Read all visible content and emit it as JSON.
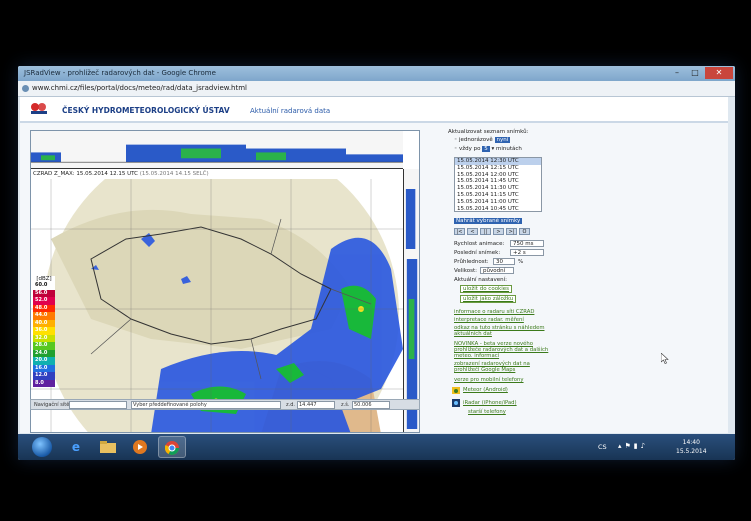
{
  "browser": {
    "title": "JSRadView - prohlížeč radarových dat - Google Chrome",
    "url": "www.chmi.cz/files/portal/docs/meteo/rad/data_jsradview.html"
  },
  "header": {
    "org_name": "ČESKÝ HYDROMETEOROLOGICKÝ ÚSTAV",
    "nav_link": "Aktuální radarová data"
  },
  "radar": {
    "product_title": "CZRAD Z_MAX: 15.05.2014 12.15 UTC",
    "product_title_local": "(15.05.2014 14.15 SELČ)",
    "legend_unit": "[dBZ]",
    "legend": [
      {
        "label": "60.0",
        "color": "#ffffff"
      },
      {
        "label": "56.0",
        "color": "#c0003a"
      },
      {
        "label": "52.0",
        "color": "#e0004c"
      },
      {
        "label": "48.0",
        "color": "#ff2a00"
      },
      {
        "label": "44.0",
        "color": "#ff7a00"
      },
      {
        "label": "40.0",
        "color": "#ffb000"
      },
      {
        "label": "36.0",
        "color": "#ffe000"
      },
      {
        "label": "32.0",
        "color": "#c8e000"
      },
      {
        "label": "28.0",
        "color": "#58c820"
      },
      {
        "label": "24.0",
        "color": "#20a030"
      },
      {
        "label": "20.0",
        "color": "#10b0b0"
      },
      {
        "label": "16.0",
        "color": "#2070e0"
      },
      {
        "label": "12.0",
        "color": "#3040c0"
      },
      {
        "label": "8.0",
        "color": "#6020a0"
      }
    ]
  },
  "bottombar": {
    "nav_label": "Navigační sítě:",
    "predef_select": "Vyber předdefinované polohy",
    "lon_label": "z.d.",
    "lon_value": "14.447",
    "lat_label": "z.š.",
    "lat_value": "50.006"
  },
  "panel": {
    "update_label": "Aktualizovat seznam snímků:",
    "once_label": "jednorázově",
    "once_btn": "nyní",
    "every_label": "vždy po",
    "every_value": "5",
    "minutes_label": "minutách",
    "times": [
      "15.05.2014   12:30 UTC",
      "15.05.2014   12:15 UTC",
      "15.05.2014   12:00 UTC",
      "15.05.2014   11:45 UTC",
      "15.05.2014   11:30 UTC",
      "15.05.2014   11:15 UTC",
      "15.05.2014   11:00 UTC",
      "15.05.2014   10:45 UTC"
    ],
    "load_btn": "Nahrát vybrané snímky",
    "nav_buttons": [
      "|<",
      "<",
      "||",
      ">",
      ">|",
      "O"
    ],
    "speed_label": "Rychlost animace:",
    "speed_value": "750 ms",
    "last_label": "Poslední snímek:",
    "last_value": "+2 s",
    "opacity_label": "Průhlednost:",
    "opacity_value": "30",
    "opacity_unit": "%",
    "size_label": "Velikost:",
    "size_value": "původní",
    "settings_label": "Aktuální nastavení:",
    "save_cookies": "uložit do cookies",
    "save_bookmark": "uložit jako záložku",
    "links": [
      "informace o radaru síti CZRAD",
      "interpretace radar. měření",
      "odkaz na tuto stránku s náhledem aktuálních dat",
      "NOVINKA - beta verze nového prohlížeče radarových dat a dalších meteo. informací",
      "zobrazení radarových dat na prohlížeči Google Maps",
      "verze pro mobilní telefony"
    ],
    "android": "Meteor (Android)",
    "iphone": "iRadar (iPhone/iPad)",
    "old_phones": "starší telefony"
  },
  "taskbar": {
    "lang": "CS",
    "time": "14:40",
    "date": "15.5.2014"
  }
}
